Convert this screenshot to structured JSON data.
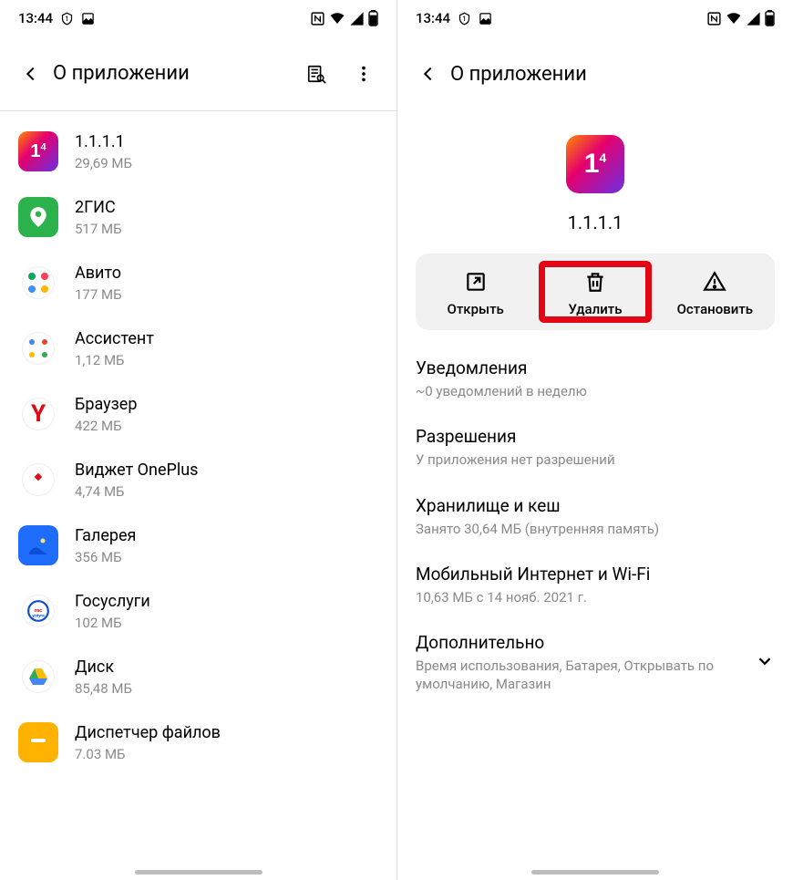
{
  "status": {
    "time": "13:44"
  },
  "left_screen": {
    "title": "О приложении",
    "apps": [
      {
        "name": "1.1.1.1",
        "size": "29,69 МБ",
        "icon": "1111"
      },
      {
        "name": "2ГИС",
        "size": "517 МБ",
        "icon": "2gis"
      },
      {
        "name": "Авито",
        "size": "177 МБ",
        "icon": "avito"
      },
      {
        "name": "Ассистент",
        "size": "1,12 МБ",
        "icon": "assist"
      },
      {
        "name": "Браузер",
        "size": "422 МБ",
        "icon": "browser"
      },
      {
        "name": "Виджет OnePlus",
        "size": "4,74 МБ",
        "icon": "widget"
      },
      {
        "name": "Галерея",
        "size": "356 МБ",
        "icon": "gallery"
      },
      {
        "name": "Госуслуги",
        "size": "102 МБ",
        "icon": "gos"
      },
      {
        "name": "Диск",
        "size": "85,48 МБ",
        "icon": "disk"
      },
      {
        "name": "Диспетчер файлов",
        "size": "7.03 МБ",
        "icon": "files"
      }
    ]
  },
  "right_screen": {
    "title": "О приложении",
    "app_name": "1.1.1.1",
    "actions": {
      "open": "Открыть",
      "delete": "Удалить",
      "stop": "Остановить"
    },
    "settings": [
      {
        "title": "Уведомления",
        "sub": "~0 уведомлений в неделю"
      },
      {
        "title": "Разрешения",
        "sub": "У приложения нет разрешений"
      },
      {
        "title": "Хранилище и кеш",
        "sub": "Занято 30,64 МБ (внутренняя память)"
      },
      {
        "title": "Мобильный Интернет и Wi-Fi",
        "sub": "10,63 МБ с 14 нояб. 2021 г."
      },
      {
        "title": "Дополнительно",
        "sub": "Время использования, Батарея, Открывать по умолчанию, Магазин",
        "chevron": true
      }
    ]
  }
}
